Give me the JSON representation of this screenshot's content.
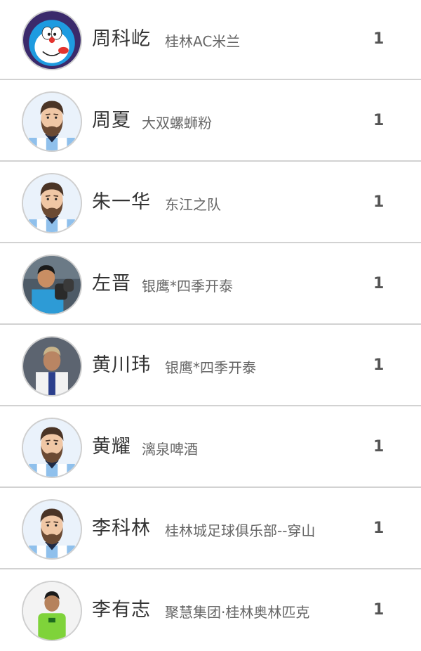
{
  "leaderboard": [
    {
      "name": "周科屹",
      "team": "桂林AC米兰",
      "count": "1",
      "avatar": "cartoon-cat-icon"
    },
    {
      "name": "周夏",
      "team": "大双螺蛳粉",
      "count": "1",
      "avatar": "bearded-player-icon"
    },
    {
      "name": "朱一华",
      "team": "东江之队",
      "count": "1",
      "avatar": "bearded-player-icon"
    },
    {
      "name": "左晋",
      "team": "银鹰*四季开泰",
      "count": "1",
      "avatar": "goalkeeper-photo"
    },
    {
      "name": "黄川玮",
      "team": "银鹰*四季开泰",
      "count": "1",
      "avatar": "player-photo"
    },
    {
      "name": "黄耀",
      "team": "漓泉啤酒",
      "count": "1",
      "avatar": "bearded-player-icon"
    },
    {
      "name": "李科林",
      "team": "桂林城足球俱乐部--穿山",
      "count": "1",
      "avatar": "bearded-player-icon"
    },
    {
      "name": "李有志",
      "team": "聚慧集团·桂林奥林匹克",
      "count": "1",
      "avatar": "player-photo"
    }
  ],
  "colors": {
    "divider": "#d2d2d2",
    "name": "#333333",
    "team": "#666666",
    "count": "#555555"
  }
}
